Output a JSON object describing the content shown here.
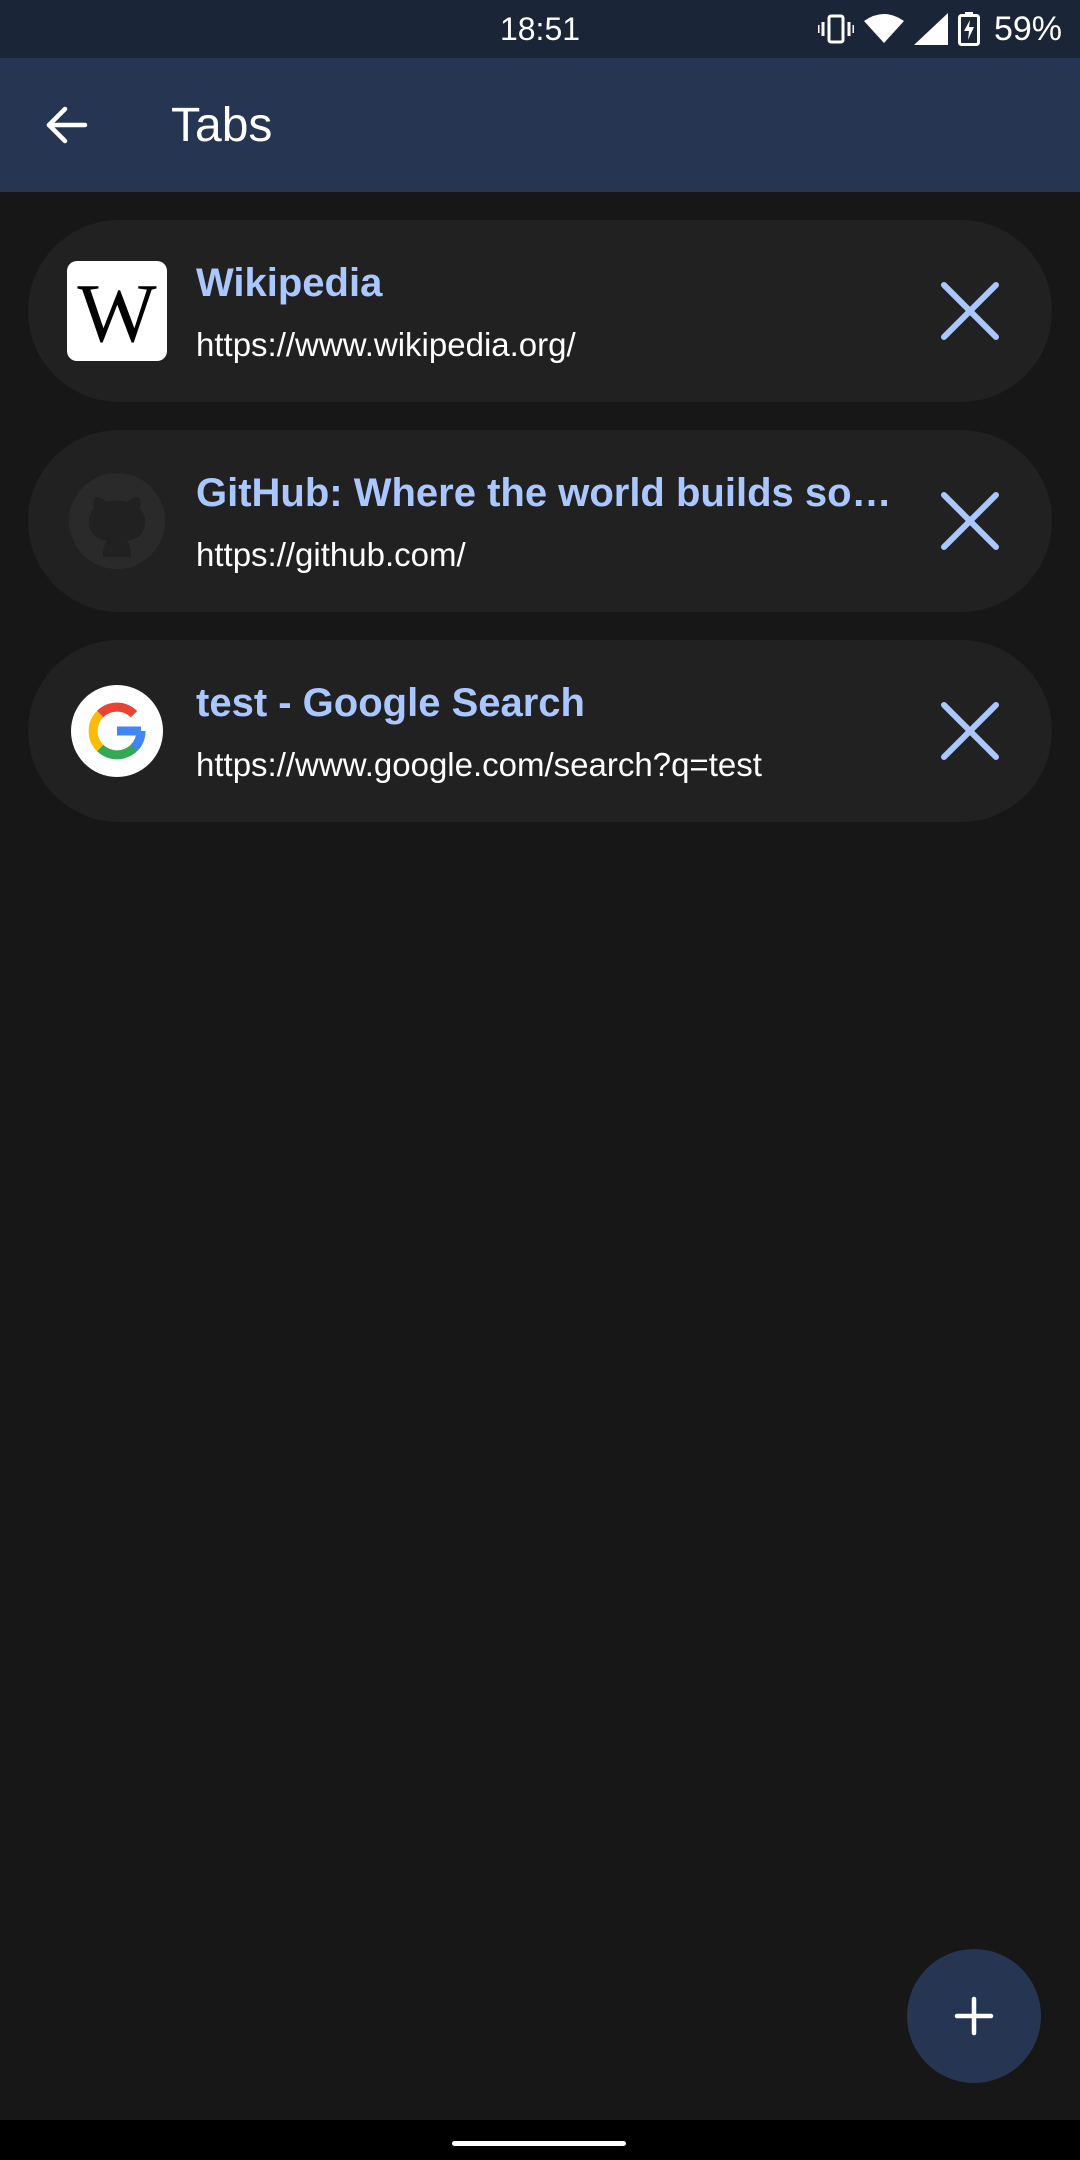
{
  "status_bar": {
    "time": "18:51",
    "battery_percent": "59%",
    "icons": [
      "vibrate-icon",
      "wifi-icon",
      "signal-icon",
      "battery-charging-icon"
    ]
  },
  "app_bar": {
    "title": "Tabs",
    "back_icon": "arrow-back-icon"
  },
  "tabs": [
    {
      "title": "Wikipedia",
      "url": "https://www.wikipedia.org/",
      "favicon": "wikipedia-favicon",
      "favicon_text": "W"
    },
    {
      "title": "GitHub: Where the world builds so…",
      "url": "https://github.com/",
      "favicon": "github-favicon"
    },
    {
      "title": "test - Google Search",
      "url": "https://www.google.com/search?q=test",
      "favicon": "google-favicon"
    }
  ],
  "fab": {
    "icon": "plus-icon"
  },
  "colors": {
    "background": "#171717",
    "status_bar": "#1b2538",
    "app_bar": "#263552",
    "card": "#212121",
    "accent": "#aac7ff",
    "text": "#ffffff"
  }
}
